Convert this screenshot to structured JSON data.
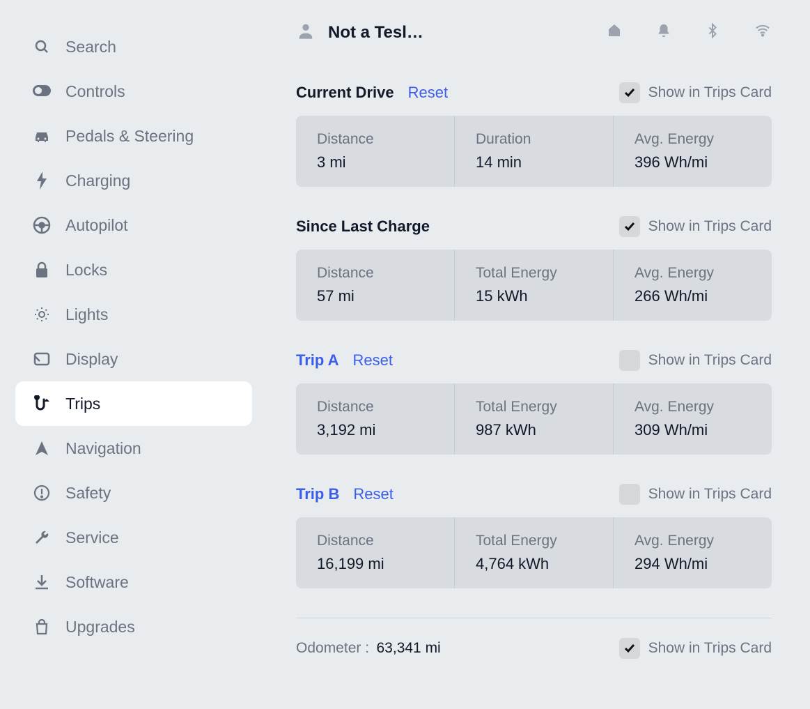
{
  "sidebar": {
    "items": [
      {
        "label": "Search",
        "icon": "search"
      },
      {
        "label": "Controls",
        "icon": "toggle"
      },
      {
        "label": "Pedals & Steering",
        "icon": "car"
      },
      {
        "label": "Charging",
        "icon": "bolt"
      },
      {
        "label": "Autopilot",
        "icon": "steering"
      },
      {
        "label": "Locks",
        "icon": "lock"
      },
      {
        "label": "Lights",
        "icon": "bulb"
      },
      {
        "label": "Display",
        "icon": "display"
      },
      {
        "label": "Trips",
        "icon": "trips",
        "active": true
      },
      {
        "label": "Navigation",
        "icon": "nav"
      },
      {
        "label": "Safety",
        "icon": "warn"
      },
      {
        "label": "Service",
        "icon": "wrench"
      },
      {
        "label": "Software",
        "icon": "download"
      },
      {
        "label": "Upgrades",
        "icon": "bag"
      }
    ]
  },
  "header": {
    "user": "Not a Tesl…"
  },
  "show_label": "Show in Trips Card",
  "reset_label": "Reset",
  "trips": [
    {
      "title": "Current Drive",
      "title_is_link": false,
      "show_reset": true,
      "checked": true,
      "metrics": [
        {
          "label": "Distance",
          "value": "3  mi"
        },
        {
          "label": "Duration",
          "value": "14  min"
        },
        {
          "label": "Avg. Energy",
          "value": "396  Wh/mi"
        }
      ]
    },
    {
      "title": "Since Last Charge",
      "title_is_link": false,
      "show_reset": false,
      "checked": true,
      "metrics": [
        {
          "label": "Distance",
          "value": "57  mi"
        },
        {
          "label": "Total Energy",
          "value": "15  kWh"
        },
        {
          "label": "Avg. Energy",
          "value": "266  Wh/mi"
        }
      ]
    },
    {
      "title": "Trip A",
      "title_is_link": true,
      "show_reset": true,
      "checked": false,
      "metrics": [
        {
          "label": "Distance",
          "value": "3,192  mi"
        },
        {
          "label": "Total Energy",
          "value": "987  kWh"
        },
        {
          "label": "Avg. Energy",
          "value": "309  Wh/mi"
        }
      ]
    },
    {
      "title": "Trip B",
      "title_is_link": true,
      "show_reset": true,
      "checked": false,
      "metrics": [
        {
          "label": "Distance",
          "value": "16,199  mi"
        },
        {
          "label": "Total Energy",
          "value": "4,764  kWh"
        },
        {
          "label": "Avg. Energy",
          "value": "294  Wh/mi"
        }
      ]
    }
  ],
  "odometer": {
    "label": "Odometer  :",
    "value": "63,341  mi",
    "checked": true
  }
}
